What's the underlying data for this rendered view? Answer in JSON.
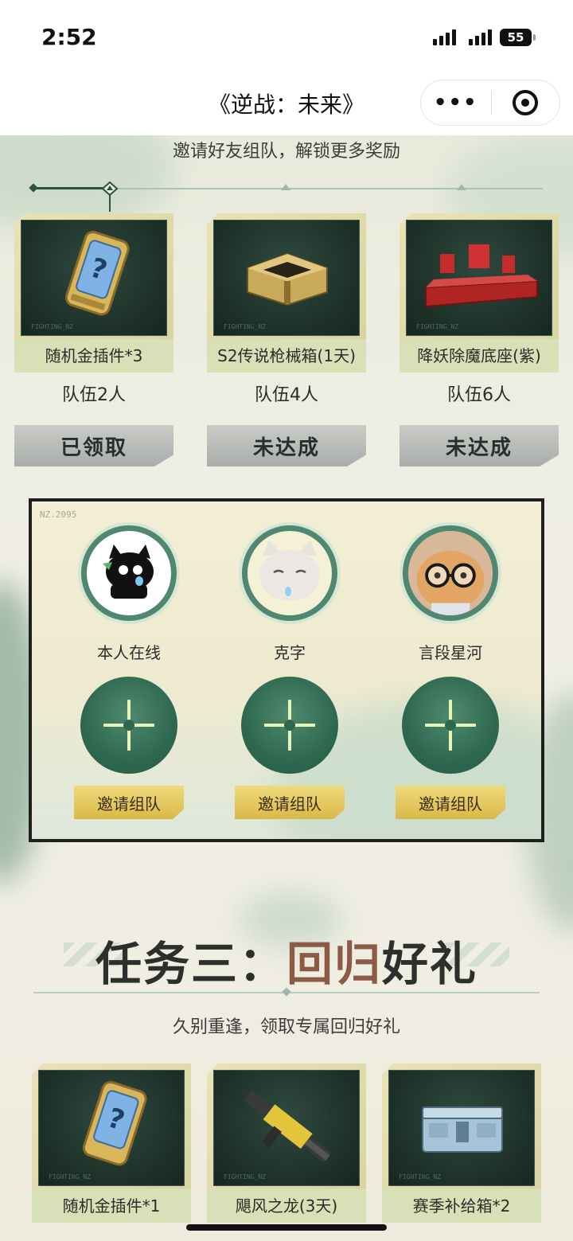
{
  "status_bar": {
    "time": "2:52",
    "battery": "55"
  },
  "nav": {
    "title": "《逆战：未来》",
    "more_icon": "more-dots-icon",
    "close_icon": "close-miniprogram-icon"
  },
  "team_section": {
    "subtitle": "邀请好友组队，解锁更多奖励",
    "rewards": [
      {
        "name": "随机金插件*3",
        "requirement": "队伍2人",
        "status": "已领取",
        "card_tag": "FIGHTING_NZ"
      },
      {
        "name": "S2传说枪械箱(1天)",
        "requirement": "队伍4人",
        "status": "未达成",
        "card_tag": "FIGHTING_NZ"
      },
      {
        "name": "降妖除魔底座(紫)",
        "requirement": "队伍6人",
        "status": "未达成",
        "card_tag": "FIGHTING_NZ"
      }
    ],
    "panel_code": "NZ.2095",
    "members": [
      {
        "name": "本人在线"
      },
      {
        "name": "克字"
      },
      {
        "name": "言段星河"
      }
    ],
    "invite_slots": [
      {
        "label": "邀请组队"
      },
      {
        "label": "邀请组队"
      },
      {
        "label": "邀请组队"
      }
    ]
  },
  "task3": {
    "title_prefix": "任务三：",
    "title_highlight": "回归",
    "title_suffix": "好礼",
    "subtitle": "久别重逢，领取专属回归好礼",
    "rewards": [
      {
        "name": "随机金插件*1",
        "card_tag": "FIGHTING_NZ"
      },
      {
        "name": "飓风之龙(3天)",
        "card_tag": "FIGHTING_NZ"
      },
      {
        "name": "赛季补给箱*2",
        "card_tag": "FIGHTING_NZ"
      }
    ]
  },
  "colors": {
    "accent_green": "#2f6850",
    "gold_button": "#e4c35c",
    "claimed_button": "#b8bcb8",
    "highlight_text": "#8c5a45"
  }
}
